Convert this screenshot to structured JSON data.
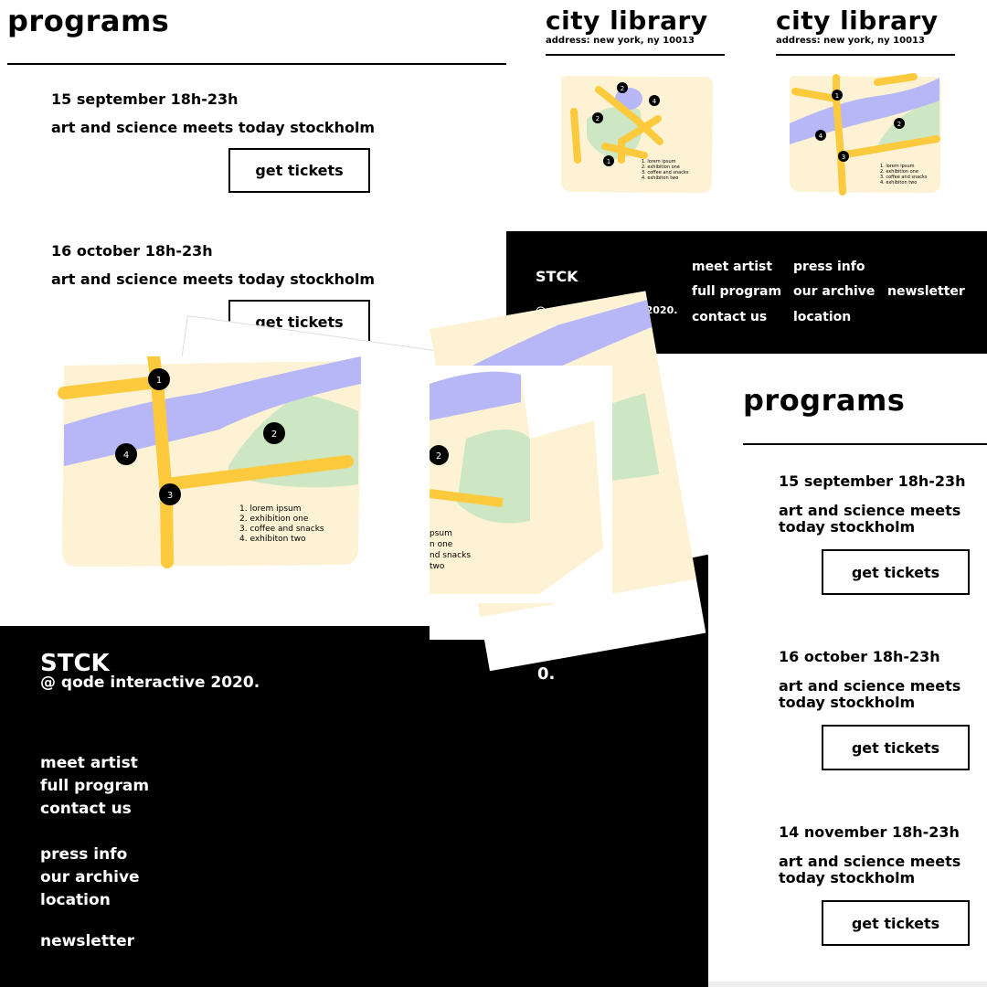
{
  "programs_title": "programs",
  "events": [
    {
      "date": "15 september 18h-23h",
      "title": "art and science meets today stockholm",
      "title_line1": "art and science meets",
      "title_line2": "today stockholm",
      "button": "get tickets"
    },
    {
      "date": "16 october 18h-23h",
      "title": "art and science meets today stockholm",
      "title_line1": "art and science meets",
      "title_line2": "today stockholm",
      "button": "get tickets"
    },
    {
      "date": "14 november 18h-23h",
      "title": "art and science meets today stockholm",
      "title_line1": "art and science meets",
      "title_line2": "today stockholm",
      "button": "get tickets"
    }
  ],
  "library": {
    "title": "city library",
    "address": "address: new york, ny 10013"
  },
  "map": {
    "pins": [
      "1",
      "2",
      "3",
      "4"
    ],
    "legend": [
      "1. lorem ipsum",
      "2. exhibition one",
      "3. coffee and snacks",
      "4. exhibiton two"
    ],
    "legend_partial": [
      "psum",
      "n one",
      "nd snacks",
      "two"
    ]
  },
  "footer": {
    "brand": "STCK",
    "copyright": "@ qode interactive 2020.",
    "copyright_fragment": "0.",
    "links": [
      "meet artist",
      "full program",
      "contact us",
      "press info",
      "our archive",
      "location",
      "newsletter"
    ]
  },
  "colors": {
    "map_bg": "#fdf2d3",
    "road": "#fcca3c",
    "river": "#b7b6f6",
    "park": "#cde6c4"
  }
}
